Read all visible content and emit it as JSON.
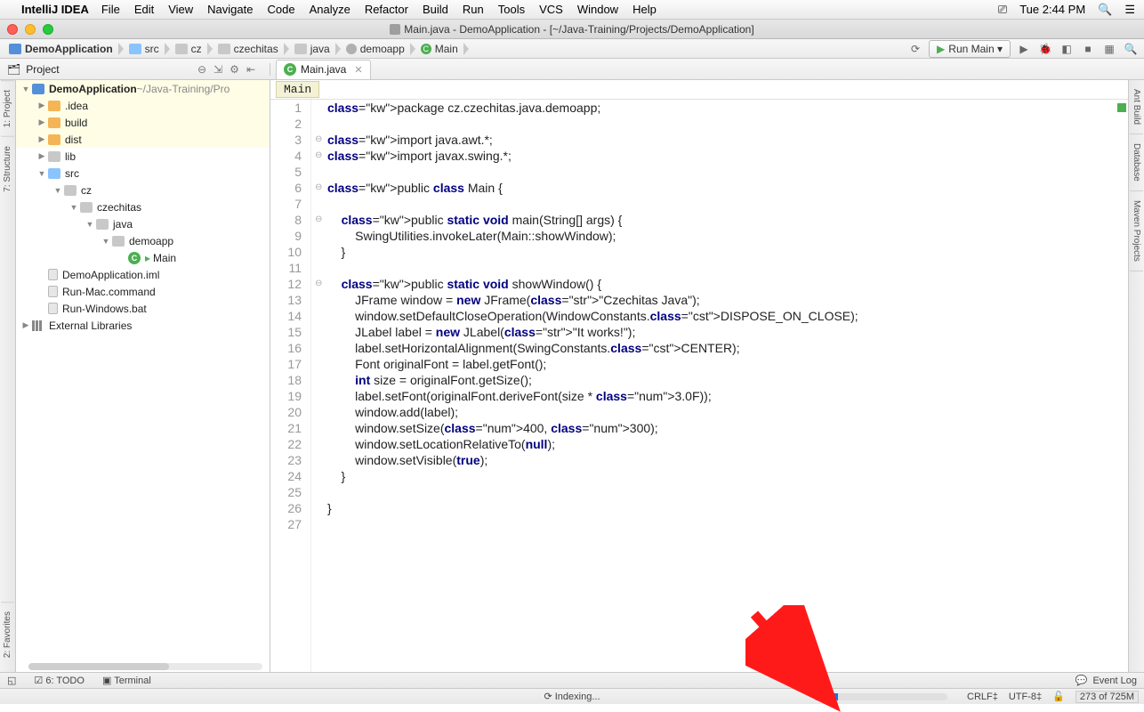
{
  "menubar": {
    "app": "IntelliJ IDEA",
    "items": [
      "File",
      "Edit",
      "View",
      "Navigate",
      "Code",
      "Analyze",
      "Refactor",
      "Build",
      "Run",
      "Tools",
      "VCS",
      "Window",
      "Help"
    ],
    "time": "Tue 2:44 PM"
  },
  "window_title": "Main.java - DemoApplication - [~/Java-Training/Projects/DemoApplication]",
  "breadcrumbs": [
    {
      "label": "DemoApplication",
      "icon": "module"
    },
    {
      "label": "src",
      "icon": "srcfolder"
    },
    {
      "label": "cz",
      "icon": "folder"
    },
    {
      "label": "czechitas",
      "icon": "folder"
    },
    {
      "label": "java",
      "icon": "folder"
    },
    {
      "label": "demoapp",
      "icon": "package"
    },
    {
      "label": "Main",
      "icon": "class"
    }
  ],
  "run_config": "Run Main ▾",
  "project_panel_label": "Project",
  "editor_tab": "Main.java",
  "editor_crumb": "Main",
  "tree": [
    {
      "depth": 0,
      "arrow": "▼",
      "icon": "module",
      "label": "DemoApplication",
      "suffix": "~/Java-Training/Pro",
      "bold": true,
      "hl": true
    },
    {
      "depth": 1,
      "arrow": "▶",
      "icon": "folder-o",
      "label": ".idea",
      "hl": true
    },
    {
      "depth": 1,
      "arrow": "▶",
      "icon": "folder-o",
      "label": "build",
      "hl": true
    },
    {
      "depth": 1,
      "arrow": "▶",
      "icon": "folder-o",
      "label": "dist",
      "hl": true
    },
    {
      "depth": 1,
      "arrow": "▶",
      "icon": "folder-g",
      "label": "lib"
    },
    {
      "depth": 1,
      "arrow": "▼",
      "icon": "folder-b",
      "label": "src"
    },
    {
      "depth": 2,
      "arrow": "▼",
      "icon": "folder-g",
      "label": "cz"
    },
    {
      "depth": 3,
      "arrow": "▼",
      "icon": "folder-g",
      "label": "czechitas"
    },
    {
      "depth": 4,
      "arrow": "▼",
      "icon": "folder-g",
      "label": "java"
    },
    {
      "depth": 5,
      "arrow": "▼",
      "icon": "folder-g",
      "label": "demoapp"
    },
    {
      "depth": 6,
      "arrow": "",
      "icon": "class",
      "label": "Main",
      "runmark": true
    },
    {
      "depth": 1,
      "arrow": "",
      "icon": "file",
      "label": "DemoApplication.iml"
    },
    {
      "depth": 1,
      "arrow": "",
      "icon": "file",
      "label": "Run-Mac.command"
    },
    {
      "depth": 1,
      "arrow": "",
      "icon": "file",
      "label": "Run-Windows.bat"
    },
    {
      "depth": 0,
      "arrow": "▶",
      "icon": "lib",
      "label": "External Libraries"
    }
  ],
  "left_tabs": [
    "1: Project",
    "7: Structure",
    "2: Favorites"
  ],
  "right_tabs": [
    "Ant Build",
    "Database",
    "Maven Projects"
  ],
  "code_lines": [
    "package cz.czechitas.java.demoapp;",
    "",
    "import java.awt.*;",
    "import javax.swing.*;",
    "",
    "public class Main {",
    "",
    "    public static void main(String[] args) {",
    "        SwingUtilities.invokeLater(Main::showWindow);",
    "    }",
    "",
    "    public static void showWindow() {",
    "        JFrame window = new JFrame(\"Czechitas Java\");",
    "        window.setDefaultCloseOperation(WindowConstants.DISPOSE_ON_CLOSE);",
    "        JLabel label = new JLabel(\"It works!\");",
    "        label.setHorizontalAlignment(SwingConstants.CENTER);",
    "        Font originalFont = label.getFont();",
    "        int size = originalFont.getSize();",
    "        label.setFont(originalFont.deriveFont(size * 3.0F));",
    "        window.add(label);",
    "        window.setSize(400, 300);",
    "        window.setLocationRelativeTo(null);",
    "        window.setVisible(true);",
    "    }",
    "",
    "}",
    ""
  ],
  "bottom_tabs": {
    "todo": "6: TODO",
    "terminal": "Terminal",
    "eventlog": "Event Log"
  },
  "status": {
    "task": "Indexing...",
    "crlf": "CRLF‡",
    "encoding": "UTF-8‡",
    "memory": "273 of 725M"
  }
}
